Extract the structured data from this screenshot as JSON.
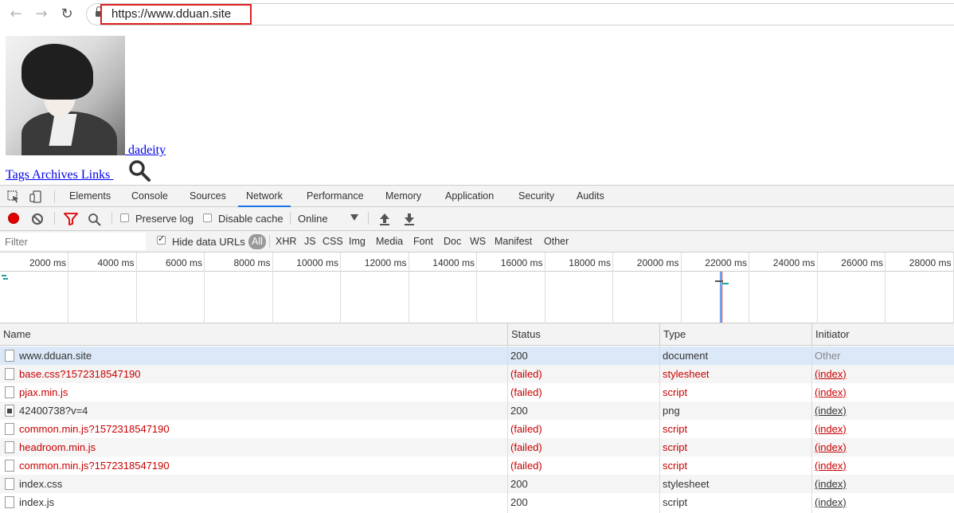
{
  "browser": {
    "url": "https://www.dduan.site"
  },
  "page": {
    "author_link": " dadeity",
    "nav_links": "Tags Archives Links "
  },
  "devtools": {
    "tabs": [
      "Elements",
      "Console",
      "Sources",
      "Network",
      "Performance",
      "Memory",
      "Application",
      "Security",
      "Audits"
    ],
    "active_tab": "Network",
    "controls": {
      "preserve_log": "Preserve log",
      "disable_cache": "Disable cache",
      "throttling": "Online"
    },
    "filter_bar": {
      "placeholder": "Filter",
      "hide_data_urls": "Hide data URLs",
      "all": "All",
      "types": [
        "XHR",
        "JS",
        "CSS",
        "Img",
        "Media",
        "Font",
        "Doc",
        "WS",
        "Manifest",
        "Other"
      ]
    },
    "timeline": {
      "ticks": [
        "2000 ms",
        "4000 ms",
        "6000 ms",
        "8000 ms",
        "10000 ms",
        "12000 ms",
        "14000 ms",
        "16000 ms",
        "18000 ms",
        "20000 ms",
        "22000 ms",
        "24000 ms",
        "26000 ms",
        "28000 ms"
      ],
      "colors": {
        "dom_loaded": "#1a73e8",
        "load": "#c00000",
        "bar": "#1aa39a"
      }
    },
    "table": {
      "headers": {
        "name": "Name",
        "status": "Status",
        "type": "Type",
        "initiator": "Initiator"
      },
      "rows": [
        {
          "name": "www.dduan.site",
          "status": "200",
          "type": "document",
          "initiator": "Other",
          "failed": false,
          "icon": "document-icon"
        },
        {
          "name": "base.css?1572318547190",
          "status": "(failed)",
          "type": "stylesheet",
          "initiator": "(index)",
          "failed": true,
          "icon": "document-icon"
        },
        {
          "name": "pjax.min.js",
          "status": "(failed)",
          "type": "script",
          "initiator": "(index)",
          "failed": true,
          "icon": "document-icon"
        },
        {
          "name": "42400738?v=4",
          "status": "200",
          "type": "png",
          "initiator": "(index)",
          "failed": false,
          "icon": "image-file-icon"
        },
        {
          "name": "common.min.js?1572318547190",
          "status": "(failed)",
          "type": "script",
          "initiator": "(index)",
          "failed": true,
          "icon": "document-icon"
        },
        {
          "name": "headroom.min.js",
          "status": "(failed)",
          "type": "script",
          "initiator": "(index)",
          "failed": true,
          "icon": "document-icon"
        },
        {
          "name": "common.min.js?1572318547190",
          "status": "(failed)",
          "type": "script",
          "initiator": "(index)",
          "failed": true,
          "icon": "document-icon"
        },
        {
          "name": "index.css",
          "status": "200",
          "type": "stylesheet",
          "initiator": "(index)",
          "failed": false,
          "icon": "document-icon"
        },
        {
          "name": "index.js",
          "status": "200",
          "type": "script",
          "initiator": "(index)",
          "failed": false,
          "icon": "document-icon"
        }
      ]
    }
  },
  "colors": {
    "highlight": "#e02020",
    "record": "#e00000",
    "failed_text": "#c80000",
    "link": "#0000ee",
    "selected_row": "#dbe8f7"
  }
}
